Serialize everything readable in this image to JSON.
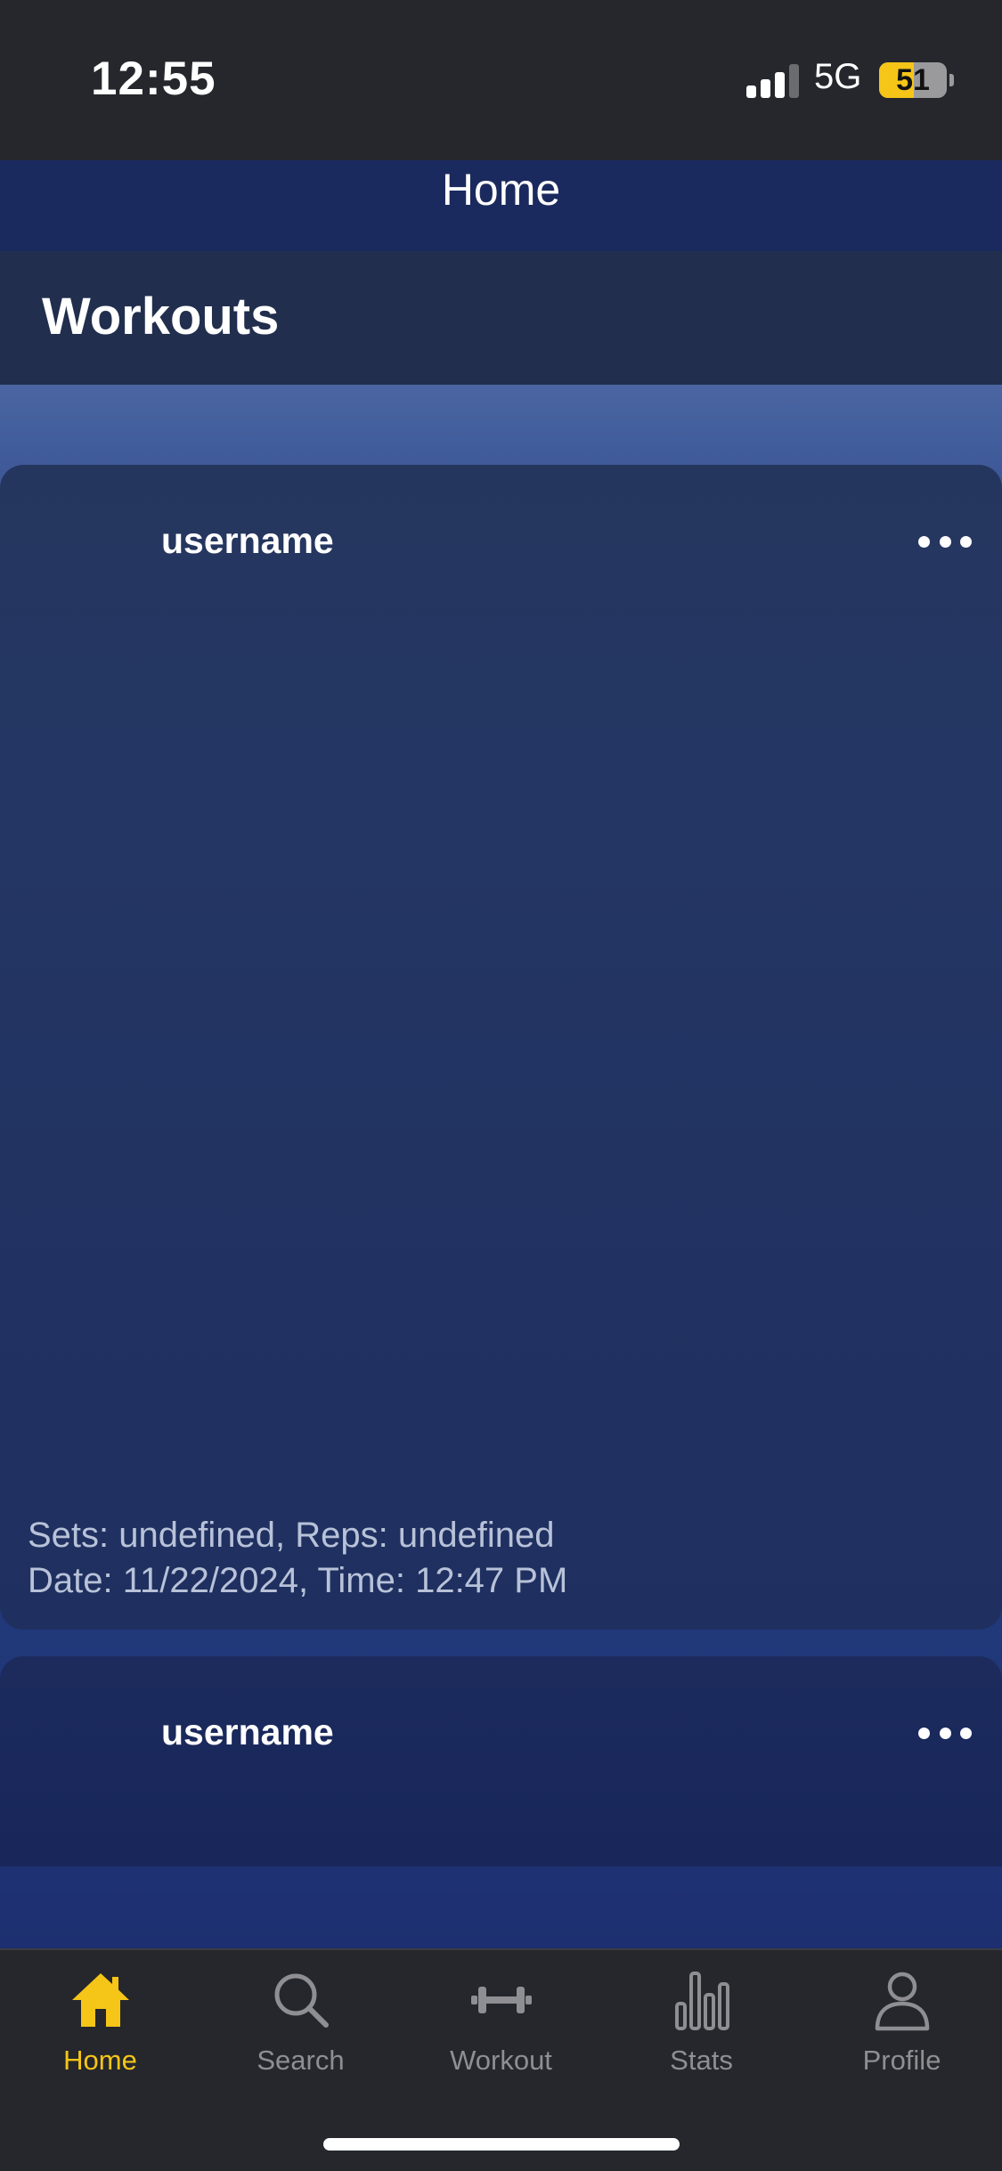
{
  "status_bar": {
    "time": "12:55",
    "network": "5G",
    "battery": "51",
    "battery_level": 0.51
  },
  "nav": {
    "title": "Home"
  },
  "section": {
    "title": "Workouts"
  },
  "posts": [
    {
      "username": "username",
      "sets_reps": "Sets: undefined, Reps: undefined",
      "datetime": "Date: 11/22/2024, Time: 12:47 PM"
    },
    {
      "username": "username"
    }
  ],
  "tabs": [
    {
      "label": "Home",
      "icon": "home-icon",
      "active": true
    },
    {
      "label": "Search",
      "icon": "search-icon",
      "active": false
    },
    {
      "label": "Workout",
      "icon": "dumbbell-icon",
      "active": false
    },
    {
      "label": "Stats",
      "icon": "bar-chart-icon",
      "active": false
    },
    {
      "label": "Profile",
      "icon": "person-icon",
      "active": false
    }
  ],
  "colors": {
    "accent": "#f5c518",
    "inactive": "#8e8e93",
    "bar_background": "#25272c"
  }
}
